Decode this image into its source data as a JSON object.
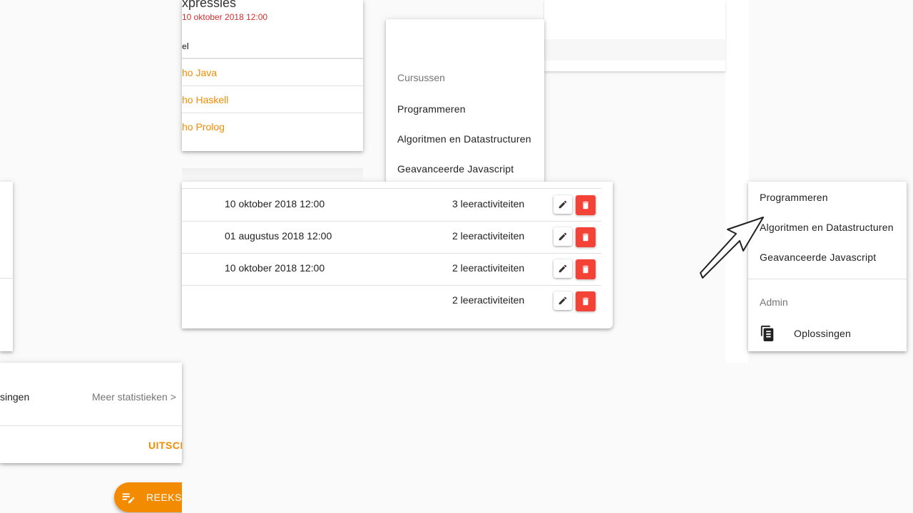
{
  "top_panel": {
    "title": "xpressies",
    "date": "10 oktober 2018 12:00",
    "column_header": "el",
    "rows": [
      "ho Java",
      "ho Haskell",
      "ho Prolog"
    ]
  },
  "courses_menu": {
    "header": "Cursussen",
    "items": [
      "Programmeren",
      "Algoritmen en Datastructuren",
      "Geavanceerde Javascript"
    ]
  },
  "series_table": {
    "rows": [
      {
        "date": "10 oktober 2018 12:00",
        "activities": "3 leeractiviteiten"
      },
      {
        "date": "01 augustus 2018 12:00",
        "activities": "2 leeractiviteiten"
      },
      {
        "date": "10 oktober 2018 12:00",
        "activities": "2 leeractiviteiten"
      },
      {
        "date": "",
        "activities": "2 leeractiviteiten"
      }
    ]
  },
  "side_menu": {
    "items": [
      "Programmeren",
      "Algoritmen en Datastructuren",
      "Geavanceerde Javascript"
    ],
    "admin_header": "Admin",
    "admin_items": [
      {
        "label": "Oplossingen",
        "icon": "document-icon"
      }
    ]
  },
  "stats_panel": {
    "label": "singen",
    "more_link": "Meer statistieken >",
    "action": "UITSCH"
  },
  "fab": {
    "label": "REEKSE",
    "icon": "playlist-edit-icon"
  },
  "colors": {
    "accent": "#f28b00",
    "danger": "#f44336",
    "date_red": "#d32f2f"
  }
}
